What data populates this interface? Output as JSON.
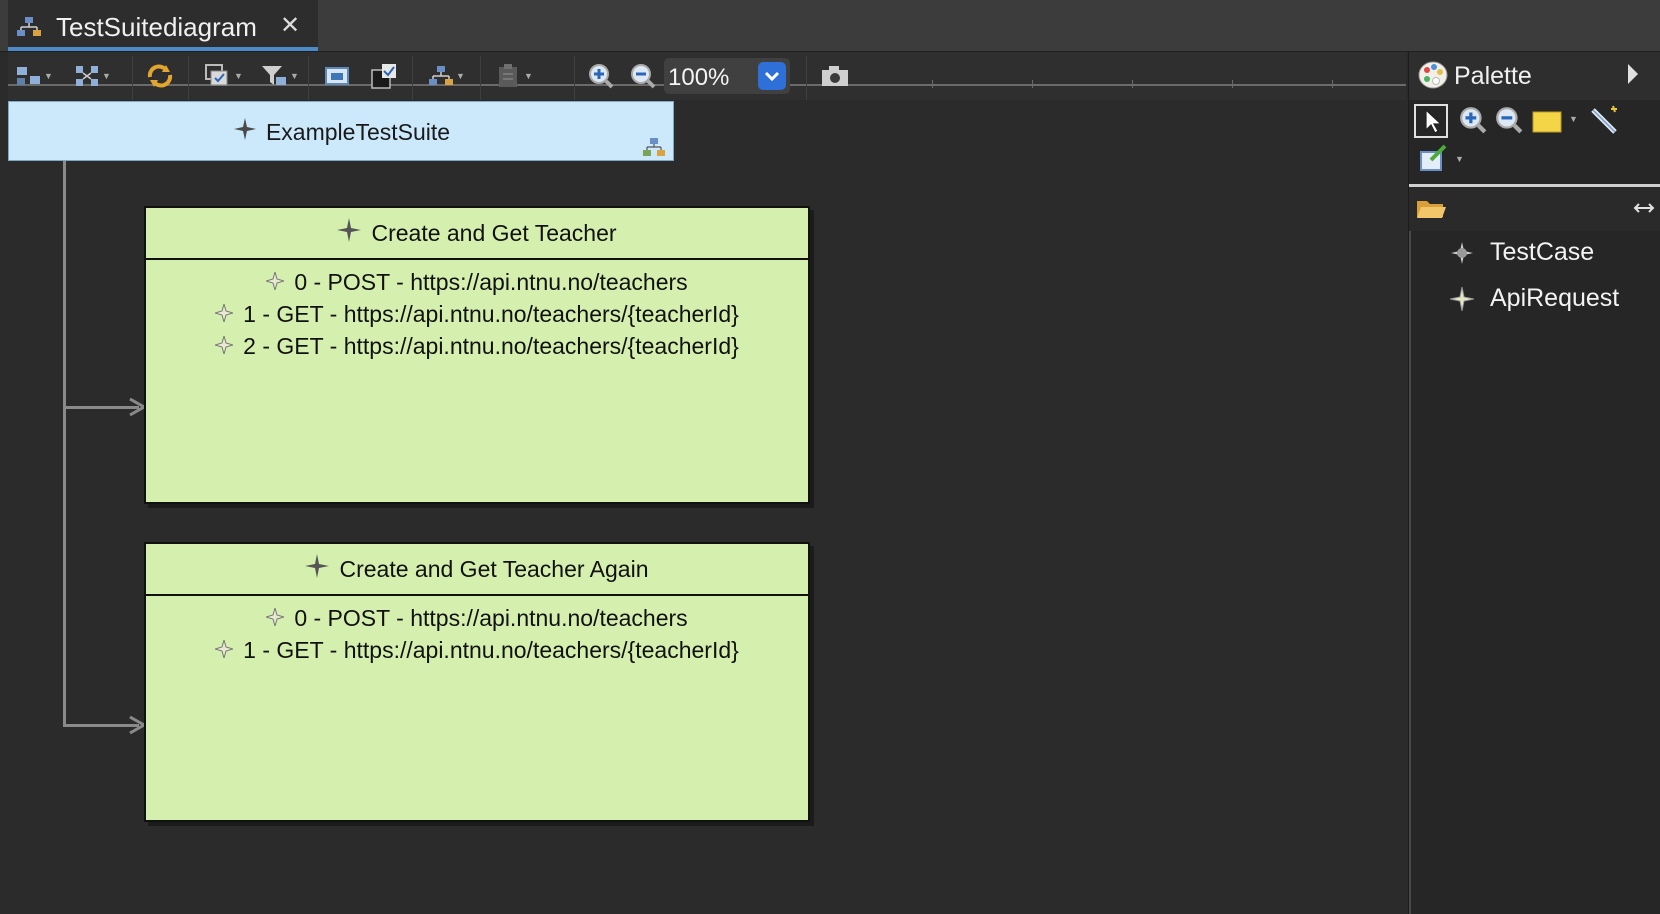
{
  "tab": {
    "title": "TestSuitediagram",
    "close_glyph": "✕"
  },
  "toolbar": {
    "zoom": "100%",
    "icons": [
      "select-all-icon",
      "arrange-icon",
      "refresh-icon",
      "layers-icon",
      "filter-icon",
      "export-icon",
      "check-icon",
      "layout-icon",
      "paste-icon",
      "zoom-in-icon",
      "zoom-out-icon",
      "camera-icon"
    ]
  },
  "diagram": {
    "suite": {
      "label": "ExampleTestSuite"
    },
    "cases": [
      {
        "title": "Create and Get Teacher",
        "requests": [
          "0 - POST - https://api.ntnu.no/teachers",
          "1 - GET - https://api.ntnu.no/teachers/{teacherId}",
          "2 - GET - https://api.ntnu.no/teachers/{teacherId}"
        ]
      },
      {
        "title": "Create and Get Teacher Again",
        "requests": [
          "0 - POST - https://api.ntnu.no/teachers",
          "1 - GET - https://api.ntnu.no/teachers/{teacherId}"
        ]
      }
    ]
  },
  "palette": {
    "title": "Palette",
    "items": [
      {
        "label": "TestCase",
        "icon": "testcase-icon"
      },
      {
        "label": "ApiRequest",
        "icon": "apirequest-icon"
      }
    ]
  },
  "colors": {
    "suite_fill": "#cbe9fb",
    "case_fill": "#d5f0ae",
    "accent": "#2f6fd8"
  }
}
